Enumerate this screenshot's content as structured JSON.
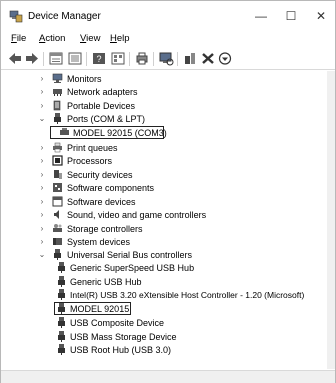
{
  "window": {
    "title": "Device Manager",
    "minimize": "—",
    "maximize": "☐",
    "close": "✕"
  },
  "menu": {
    "file": "F",
    "file_rest": "ile",
    "action": "A",
    "action_rest": "ction",
    "view": "V",
    "view_rest": "iew",
    "help": "H",
    "help_rest": "elp"
  },
  "tree": {
    "monitors": "Monitors",
    "network": "Network adapters",
    "portable": "Portable Devices",
    "ports": "Ports (COM & LPT)",
    "model_com": "MODEL 92015 (COM3)",
    "print": "Print queues",
    "processors": "Processors",
    "security": "Security devices",
    "software_components": "Software components",
    "software_devices": "Software devices",
    "sound": "Sound, video and game controllers",
    "storage": "Storage controllers",
    "system": "System devices",
    "usb": "Universal Serial Bus controllers",
    "usb_superspeed": "Generic SuperSpeed USB Hub",
    "usb_generic": "Generic USB Hub",
    "usb_intel": "Intel(R) USB 3.20 eXtensible Host Controller - 1.20 (Microsoft)",
    "usb_model": "MODEL 92015",
    "usb_composite": "USB Composite Device",
    "usb_mass": "USB Mass Storage Device",
    "usb_root": "USB Root Hub (USB 3.0)"
  },
  "icons": {
    "back": "back-arrow-icon",
    "forward": "forward-arrow-icon",
    "properties": "properties-icon",
    "help": "help-icon",
    "scan": "scan-icon",
    "update": "update-driver-icon",
    "uninstall": "uninstall-icon",
    "enable": "enable-device-icon"
  }
}
